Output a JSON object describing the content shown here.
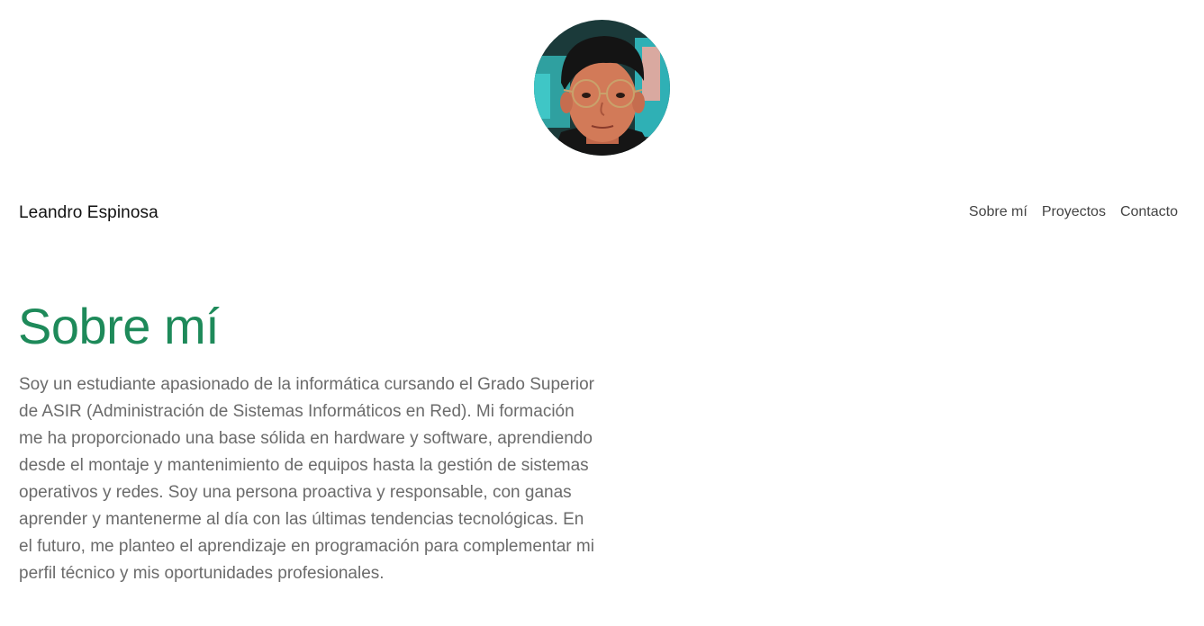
{
  "profile": {
    "avatar_alt": "Leandro Espinosa"
  },
  "header": {
    "brand": "Leandro Espinosa",
    "nav": [
      {
        "label": "Sobre mí"
      },
      {
        "label": "Proyectos"
      },
      {
        "label": "Contacto"
      }
    ]
  },
  "about": {
    "title": "Sobre mí",
    "text": "Soy un estudiante apasionado de la informática cursando el Grado Superior de ASIR (Administración de Sistemas Informáticos en Red). Mi formación me ha proporcionado una base sólida en hardware y software, aprendiendo desde el montaje y mantenimiento de equipos hasta la gestión de sistemas operativos y redes. Soy una persona proactiva y responsable, con ganas aprender y mantenerme al día con las últimas tendencias tecnológicas. En el futuro, me planteo el aprendizaje en programación para complementar mi perfil técnico y mis oportunidades profesionales."
  },
  "colors": {
    "accent": "#1e8a5a",
    "body_text": "#6b6b6b",
    "nav_text": "#444444"
  }
}
